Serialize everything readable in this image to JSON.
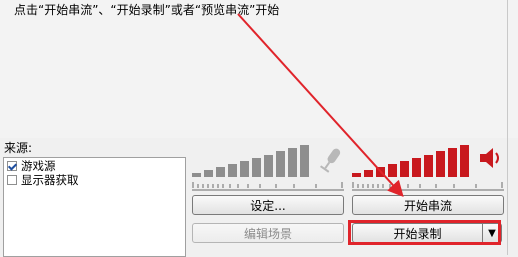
{
  "instruction_text": "点击“开始串流”、“开始录制”或者“预览串流”开始",
  "sources": {
    "label": "来源:",
    "items": [
      {
        "label": "游戏源",
        "checked": true
      },
      {
        "label": "显示器获取",
        "checked": false
      }
    ]
  },
  "buttons": {
    "settings": "设定...",
    "start_streaming": "开始串流",
    "edit_scene": "编辑场景",
    "start_recording": "开始录制",
    "dropdown_icon": "▼"
  },
  "icons": {
    "mic": "microphone-muted-icon",
    "speaker": "speaker-icon"
  },
  "colors": {
    "annotation_red": "#e0242b",
    "meter_red": "#c8191e",
    "meter_gray": "#8e8e8e"
  }
}
